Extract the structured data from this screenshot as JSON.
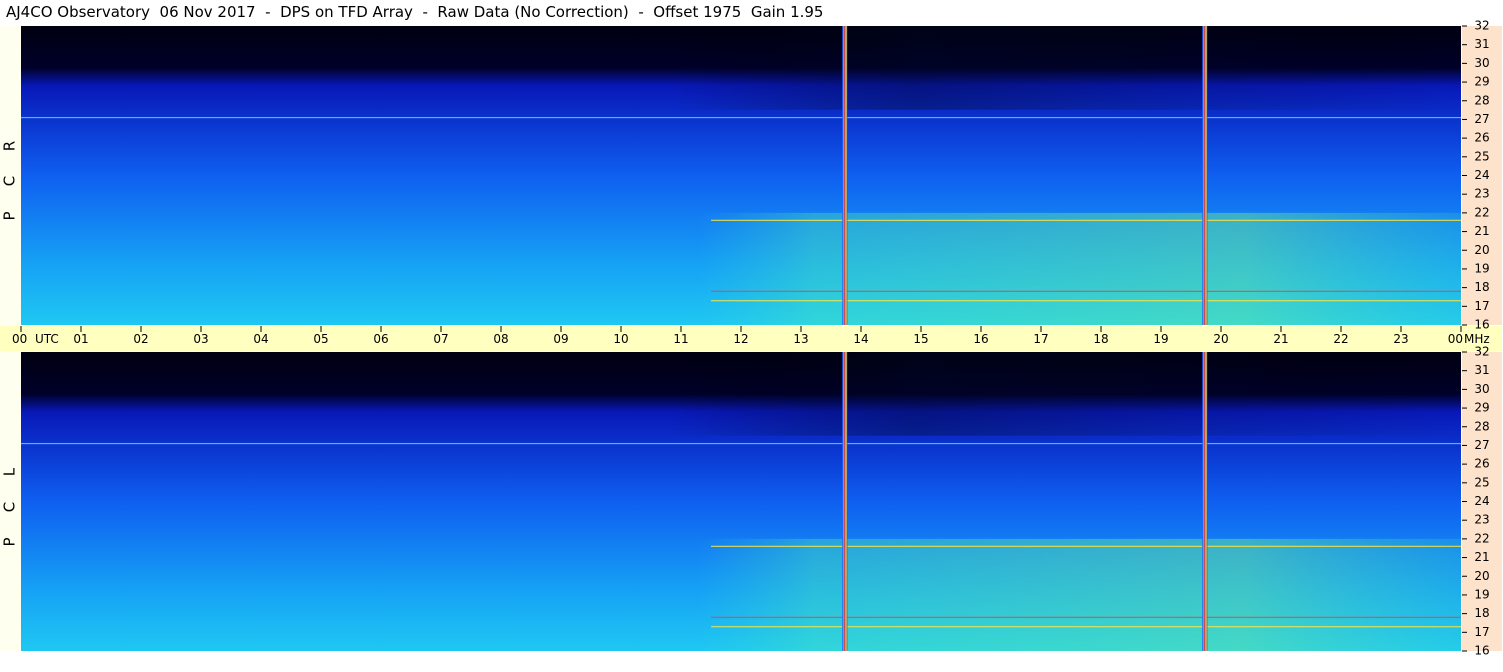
{
  "title": "AJ4CO Observatory  06 Nov 2017  -  DPS on TFD Array  -  Raw Data (No Correction)  -  Offset 1975  Gain 1.95",
  "colors": {
    "time_band": "#ffffc0",
    "freq_strip": "#fde2cc",
    "left_strip": "#fffff0"
  },
  "chart_data": {
    "type": "heatmap",
    "panels": [
      {
        "name": "RCP",
        "label_letters": [
          "R",
          "C",
          "P"
        ]
      },
      {
        "name": "LCP",
        "label_letters": [
          "L",
          "C",
          "P"
        ]
      }
    ],
    "x_ticks": [
      "00",
      "01",
      "02",
      "03",
      "04",
      "05",
      "06",
      "07",
      "08",
      "09",
      "10",
      "11",
      "12",
      "13",
      "14",
      "15",
      "16",
      "17",
      "18",
      "19",
      "20",
      "21",
      "22",
      "23",
      "00"
    ],
    "x_unit": "UTC",
    "x_range_hours": [
      0,
      24
    ],
    "y_ticks": [
      "32",
      "31",
      "30",
      "29",
      "28",
      "27",
      "26",
      "25",
      "24",
      "23",
      "22",
      "21",
      "20",
      "19",
      "18",
      "17",
      "16"
    ],
    "y_unit": "MHz",
    "y_range_mhz": [
      16,
      32
    ],
    "vertical_interference_lines_utc": [
      13.73,
      19.73
    ],
    "horizontal_lines_mhz": [
      27.1,
      21.6,
      17.8,
      17.3
    ]
  }
}
